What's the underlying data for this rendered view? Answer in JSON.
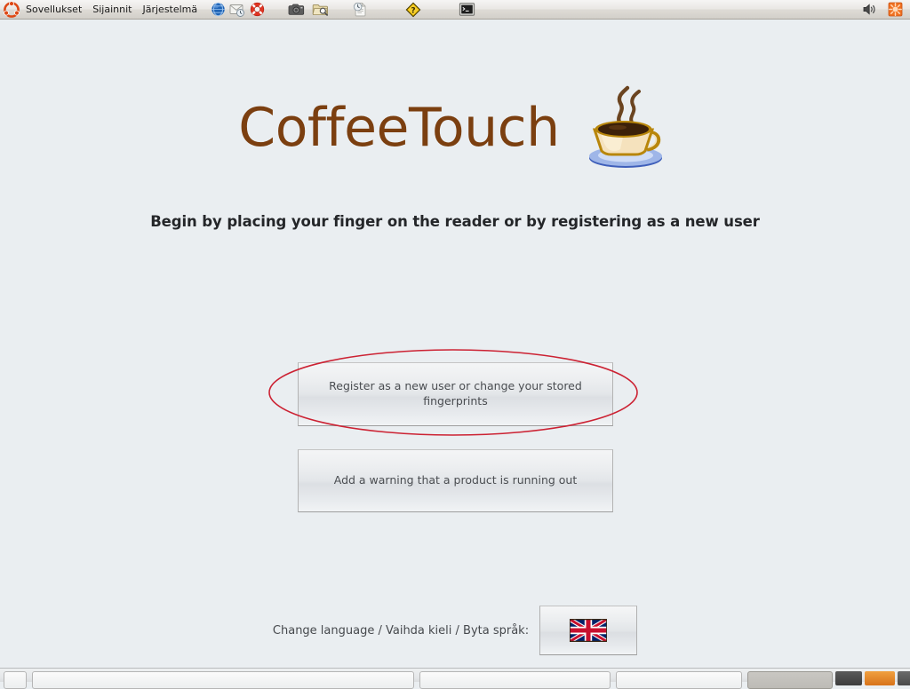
{
  "desktop": {
    "background_color": "#eaeef1",
    "top_panel": {
      "logo_icon": "ubuntu-logo-icon",
      "menus": [
        {
          "label": "Sovellukset",
          "name": "menu-sovellukset"
        },
        {
          "label": "Sijainnit",
          "name": "menu-sijainnit"
        },
        {
          "label": "Järjestelmä",
          "name": "menu-jarjestelma"
        }
      ],
      "launchers": [
        {
          "icon": "globe-browser-icon",
          "name": "launcher-web-browser"
        },
        {
          "icon": "mail-clock-icon",
          "name": "launcher-mail"
        },
        {
          "icon": "lifebuoy-help-icon",
          "name": "launcher-help"
        },
        {
          "icon": "camera-icon",
          "name": "launcher-screenshot"
        },
        {
          "icon": "folder-search-icon",
          "name": "launcher-file-search"
        },
        {
          "icon": "document-clock-icon",
          "name": "launcher-recent-documents"
        },
        {
          "icon": "yellow-diamond-question-icon",
          "name": "launcher-question"
        },
        {
          "icon": "terminal-icon",
          "name": "launcher-terminal"
        }
      ],
      "tray": [
        {
          "icon": "volume-speaker-icon",
          "name": "tray-volume"
        },
        {
          "icon": "update-manager-icon",
          "name": "tray-update-manager",
          "color": "#f07020"
        }
      ]
    },
    "bottom_panel": {
      "show_desktop_label": "",
      "task_buttons": [
        {
          "label": "",
          "active": false
        },
        {
          "label": "",
          "active": false
        },
        {
          "label": "",
          "active": false
        },
        {
          "label": "",
          "active": false
        },
        {
          "label": "",
          "active": true
        }
      ]
    }
  },
  "app": {
    "title": "CoffeeTouch",
    "title_color": "#7b3f10",
    "logo_icon": "coffee-cup-icon",
    "subtitle": "Begin by placing your finger on the reader or by registering as a new user",
    "buttons": [
      {
        "name": "register-button",
        "label": "Register as a new user or change your stored fingerprints",
        "annotated": true
      },
      {
        "name": "add-warning-button",
        "label": "Add a warning that a product is running out",
        "annotated": false
      }
    ],
    "language": {
      "label": "Change language / Vaihda kieli / Byta språk:",
      "flag_icon": "union-jack-flag-icon",
      "selected": "English"
    },
    "annotation": {
      "shape": "ellipse",
      "color": "#cc2233",
      "target": "register-button"
    }
  }
}
